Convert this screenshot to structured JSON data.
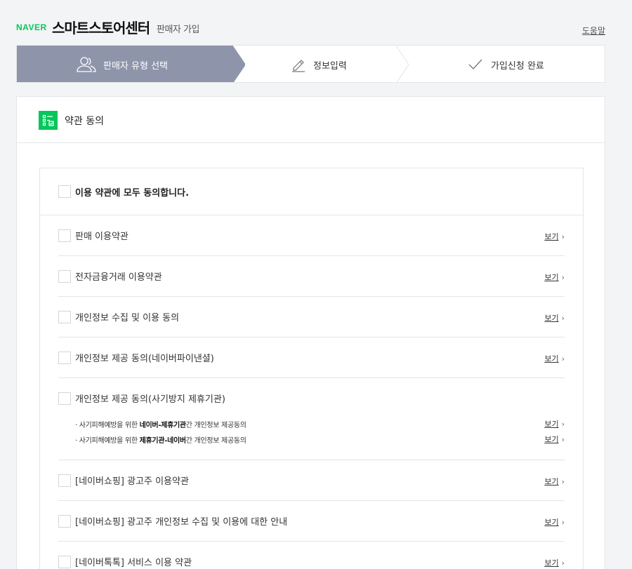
{
  "header": {
    "logo": "NAVER",
    "brand": "스마트스토어센터",
    "subtitle": "판매자 가입",
    "help": "도움말"
  },
  "steps": [
    {
      "label": "판매자 유형 선택",
      "icon": "users-icon",
      "active": true
    },
    {
      "label": "정보입력",
      "icon": "pencil-icon",
      "active": false
    },
    {
      "label": "가입신청 완료",
      "icon": "check-icon",
      "active": false
    }
  ],
  "panel": {
    "title": "약관 동의",
    "title_icon": "checklist-icon"
  },
  "agree_all": "이용 약관에 모두 동의합니다.",
  "view_label": "보기",
  "terms": [
    "판매 이용약관",
    "전자금융거래 이용약관",
    "개인정보 수집 및 이용 동의",
    "개인정보 제공 동의(네이버파이낸셜)",
    "개인정보 제공 동의(사기방지 제휴기관)",
    "[네이버쇼핑] 광고주 이용약관",
    "[네이버쇼핑] 광고주 개인정보 수집 및 이용에 대한 안내",
    "[네이버톡톡] 서비스 이용 약관"
  ],
  "sub_items": [
    {
      "prefix": "· 사기피해예방을 위한 ",
      "bold": "네이버-제휴기관",
      "suffix": "간 개인정보 제공동의"
    },
    {
      "prefix": "· 사기피해예방을 위한 ",
      "bold": "제휴기관-네이버",
      "suffix": "간 개인정보 제공동의"
    }
  ],
  "colors": {
    "brand_green": "#03c75a",
    "step_active": "#8e95ab",
    "background": "#f3f4f6"
  }
}
